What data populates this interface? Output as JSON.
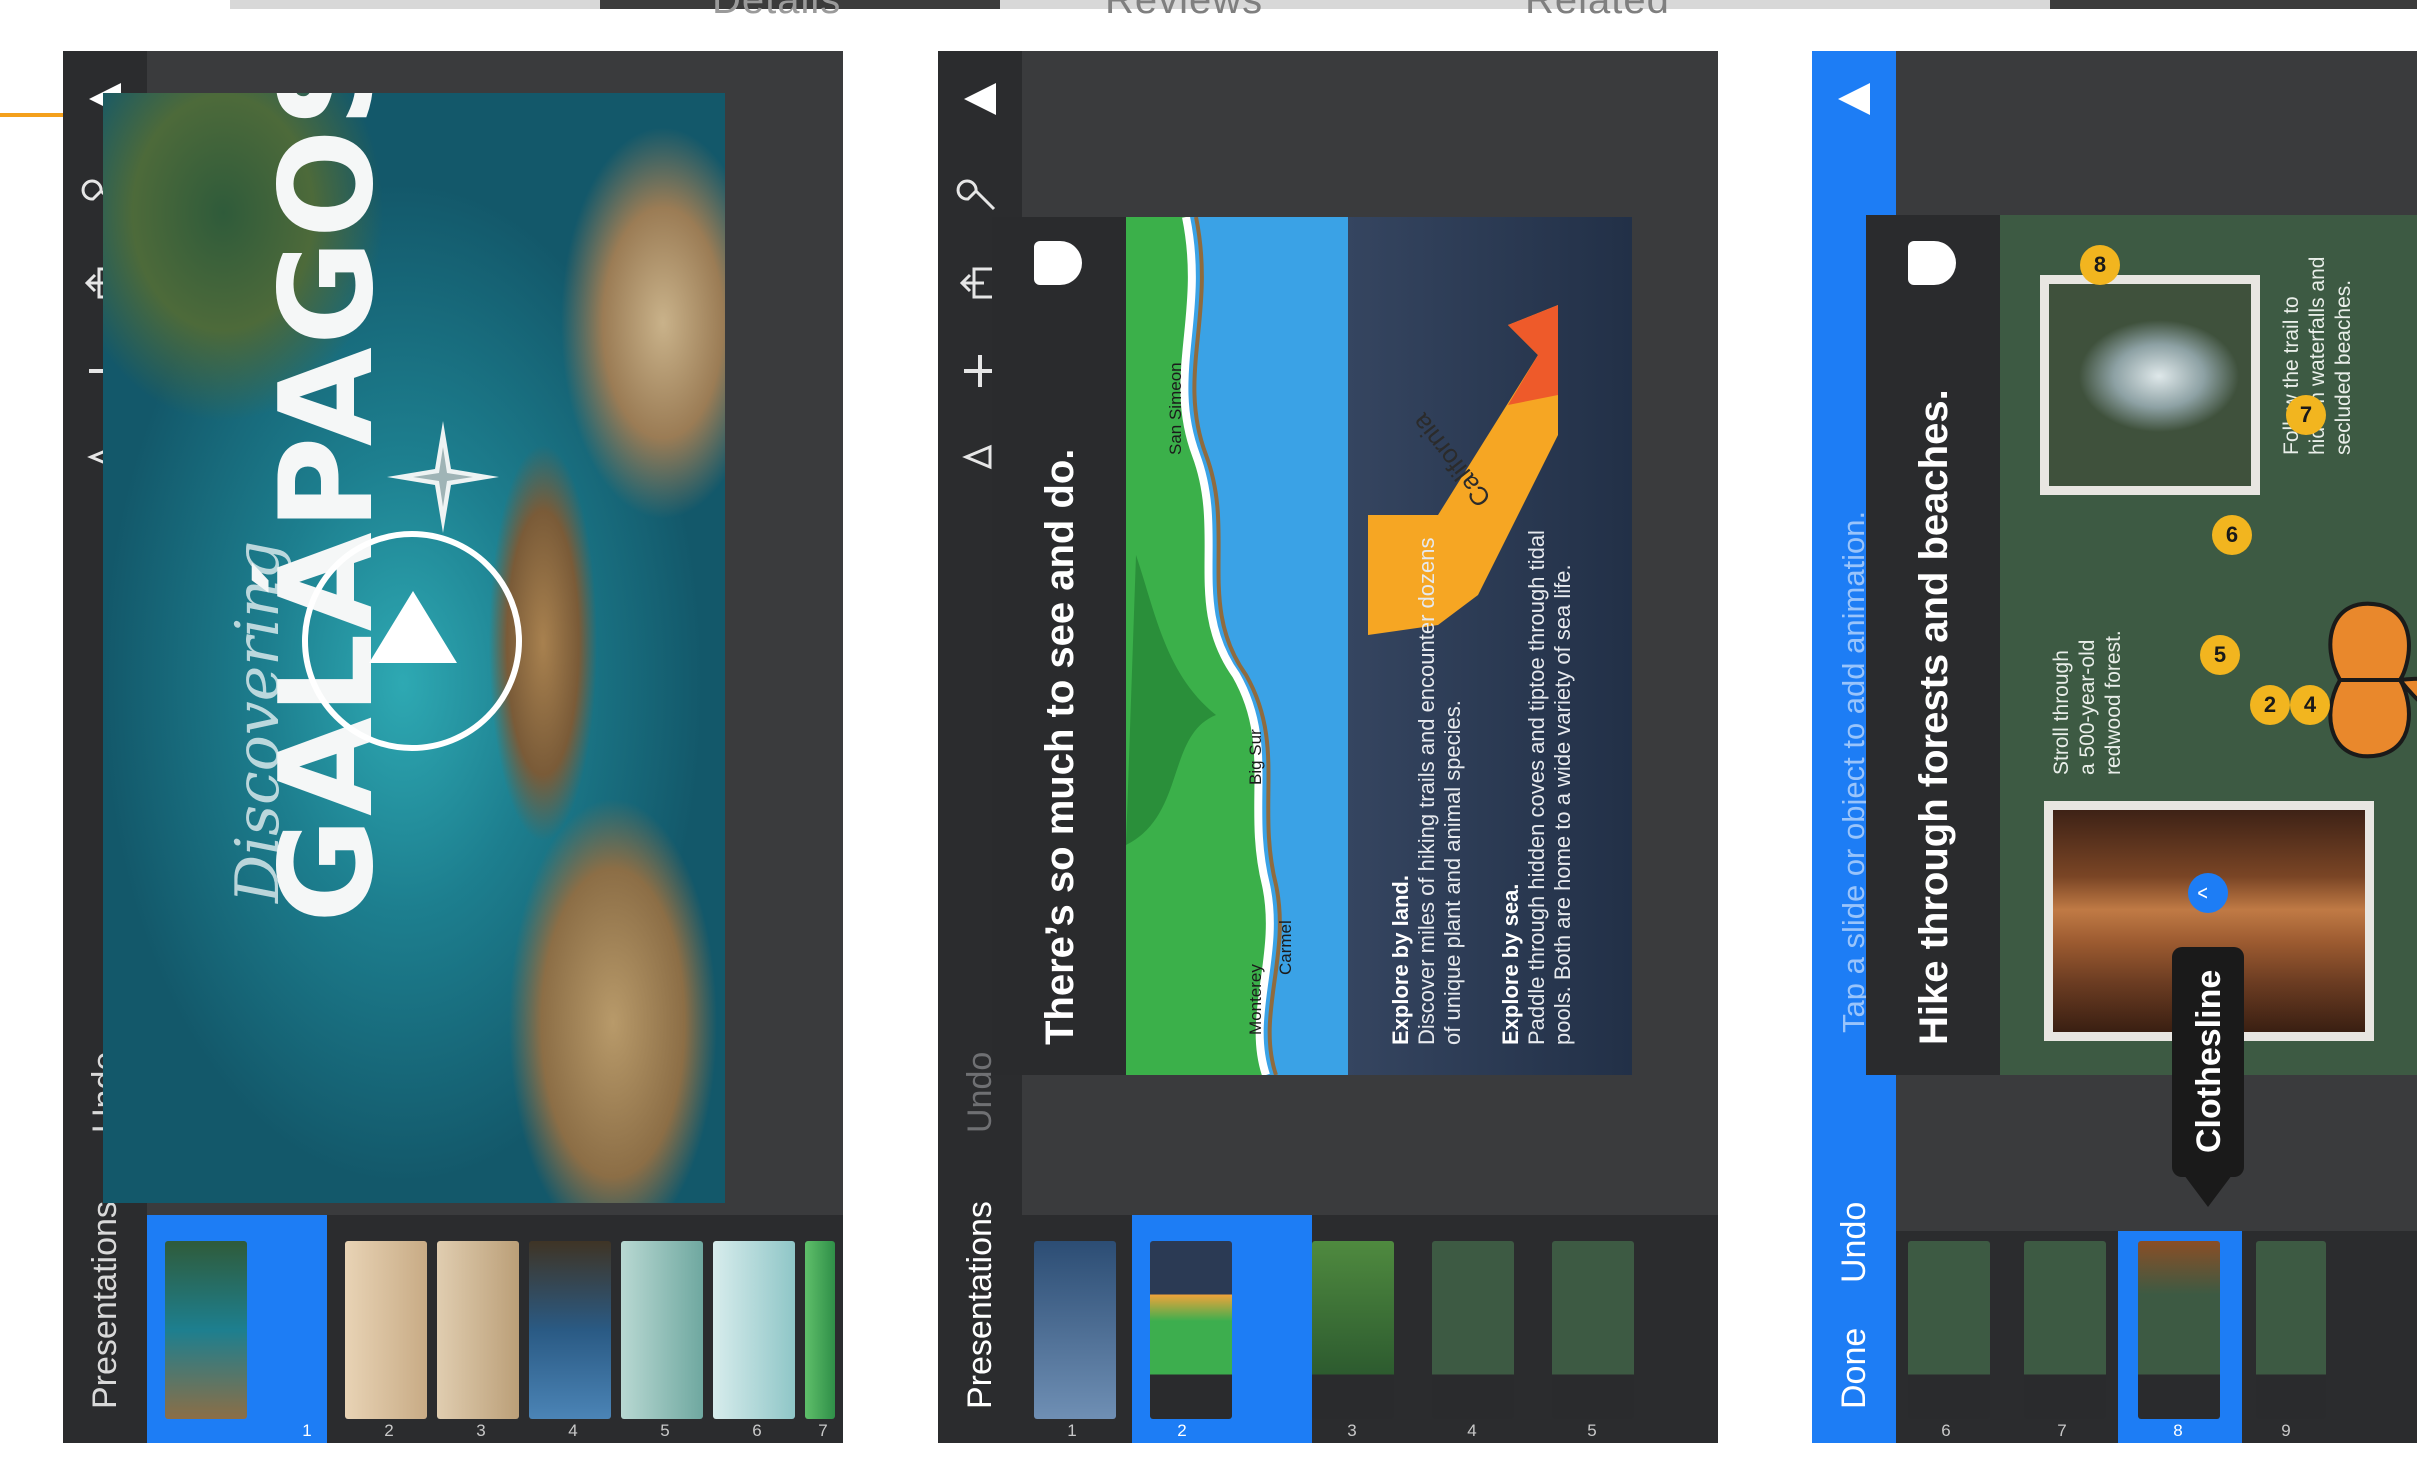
{
  "page_header": {
    "tabs": [
      "Details",
      "Reviews",
      "Related"
    ]
  },
  "colors": {
    "accent_blue": "#1d7df5",
    "callout_orange": "#f4a01c",
    "toolbar_dark": "#2b2c2e",
    "panel_bg": "#3a3b3d"
  },
  "panels": [
    {
      "toolbar": {
        "presentations_label": "Presentations",
        "undo_label": "Undo",
        "icons": [
          "triangle-icon",
          "wrench-icon",
          "share-icon",
          "plus-icon",
          "animation-icon"
        ]
      },
      "slide_numbers": [
        "1",
        "2",
        "3",
        "4",
        "5",
        "6",
        "7"
      ],
      "selected_slide": "1",
      "slide": {
        "script_title": "Discovering",
        "title": "GALÁPAGOS"
      }
    },
    {
      "toolbar": {
        "presentations_label": "Presentations",
        "undo_label": "Undo",
        "icons": [
          "triangle-icon",
          "wrench-icon",
          "share-icon",
          "plus-icon",
          "animation-icon"
        ]
      },
      "slide_numbers": [
        "1",
        "2",
        "3",
        "4",
        "5"
      ],
      "selected_slide": "2",
      "slide": {
        "title": "There’s so much to see and do.",
        "map_labels": [
          "Monterey",
          "Carmel",
          "Big Sur",
          "San Simeon"
        ],
        "state_label": "California",
        "land_heading": "Explore by land.",
        "land_text_1": "Discover miles of hiking trails and encounter dozens",
        "land_text_2": "of unique plant and animal species.",
        "sea_heading": "Explore by sea.",
        "sea_text_1": "Paddle through hidden coves and tiptoe through tidal",
        "sea_text_2": "pools. Both are home to a wide variety of sea life."
      }
    },
    {
      "toolbar": {
        "done_label": "Done",
        "undo_label": "Undo",
        "hint": "Tap a slide or object to add animation."
      },
      "slide_numbers": [
        "6",
        "7",
        "8",
        "9"
      ],
      "selected_slide": "8",
      "slide": {
        "title": "Hike through forests and beaches.",
        "caption_1_line_1": "Stroll through",
        "caption_1_line_2": "a 500-year-old",
        "caption_1_line_3": "redwood forest.",
        "caption_2_line_1": "Follow the trail to",
        "caption_2_line_2": "hidden waterfalls and",
        "caption_2_line_3": "secluded beaches.",
        "pins": [
          "2",
          "4",
          "5",
          "6",
          "7",
          "8"
        ]
      },
      "tooltip": {
        "label": "Clothesline"
      }
    }
  ]
}
